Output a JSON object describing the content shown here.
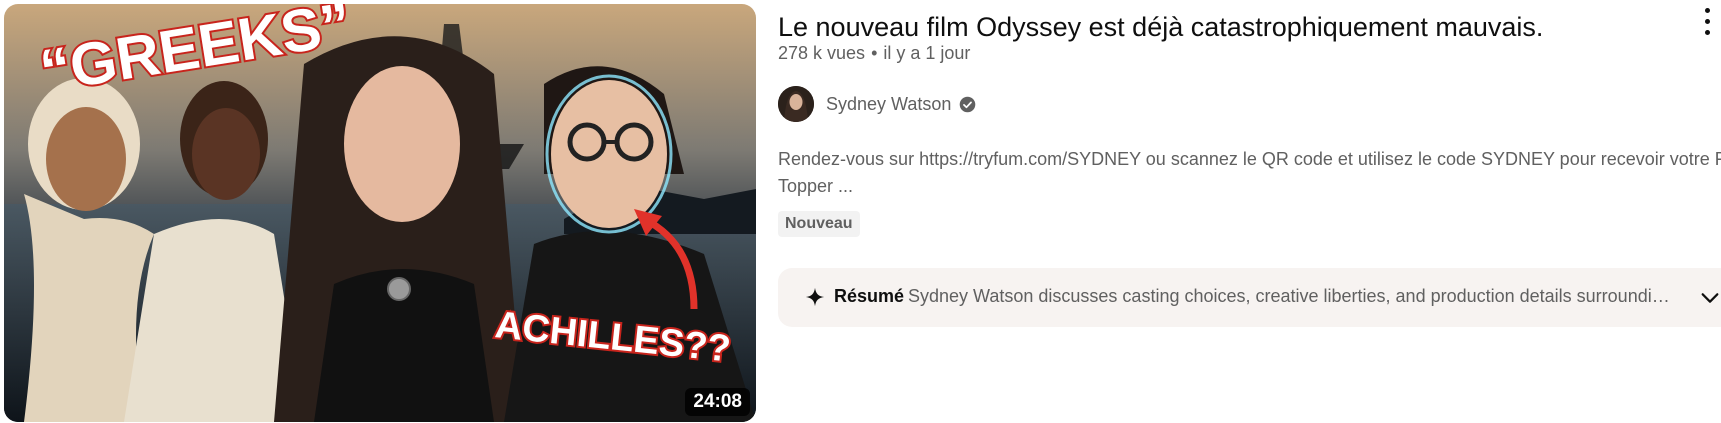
{
  "video": {
    "title": "Le nouveau film Odyssey est déjà catastrophiquement mauvais.",
    "views": "278 k vues",
    "separator": "•",
    "age": "il y a 1 jour",
    "duration": "24:08",
    "channel": "Sydney Watson",
    "description_line1": "Rendez-vous sur https://tryfum.com/SYDNEY ou scannez le QR code et utilisez le code SYDNEY pour recevoir votre Fu",
    "description_line2": "Topper ...",
    "badge": "Nouveau"
  },
  "thumbnail": {
    "text_top": "“GREEKS”",
    "text_bottom": "ACHILLES??"
  },
  "summary": {
    "label": "Résumé",
    "text": "Sydney Watson discusses casting choices, creative liberties, and production details surrounding the new Odyssey film"
  },
  "icons": {
    "menu": "three-dots-vertical-icon",
    "verified": "verified-check-icon",
    "spark": "sparkle-icon",
    "expand": "chevron-down-icon"
  },
  "colors": {
    "summary_bg": "#f7f3f1",
    "secondary_text": "#606060",
    "primary_text": "#0f0f0f"
  }
}
